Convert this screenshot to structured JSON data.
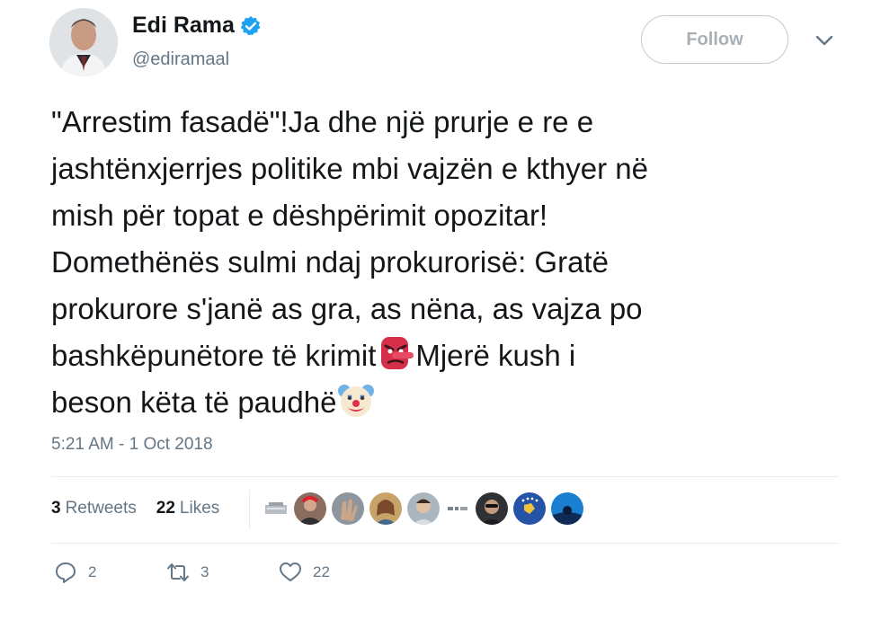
{
  "author": {
    "name": "Edi Rama",
    "handle": "@ediramaal",
    "verified": true
  },
  "follow_label": "Follow",
  "tweet": {
    "line1": "\"Arrestim fasadë\"!Ja dhe një prurje e re e",
    "line2": "jashtënxjerrjes politike mbi vajzën e kthyer në",
    "line3": "mish për topat e dëshpërimit opozitar!",
    "line4": "Domethënës sulmi ndaj prokurorisë: Gratë",
    "line5": "prokurore s'janë as gra, as nëna, as vajza po",
    "line6a": "bashkëpunëtore të krimit",
    "line6b": "Mjerë kush i",
    "line7": "beson këta të paudhë",
    "emoji1": "tengu-mask-emoji",
    "emoji2": "clown-face-emoji"
  },
  "timestamp": "5:21 AM - 1 Oct 2018",
  "stats": {
    "retweets_count": "3",
    "retweets_label": "Retweets",
    "likes_count": "22",
    "likes_label": "Likes"
  },
  "liker_avatars": [
    "liker-avatar-1",
    "liker-avatar-2",
    "liker-avatar-3",
    "liker-avatar-4",
    "liker-avatar-5",
    "liker-avatar-6",
    "liker-avatar-7",
    "liker-avatar-8",
    "liker-avatar-9",
    "liker-avatar-10"
  ],
  "actions": {
    "reply_count": "2",
    "retweet_count": "3",
    "like_count": "22"
  },
  "colors": {
    "text": "#14171a",
    "muted": "#657786",
    "verified_blue": "#1da1f2",
    "divider": "#e6ecf0"
  }
}
